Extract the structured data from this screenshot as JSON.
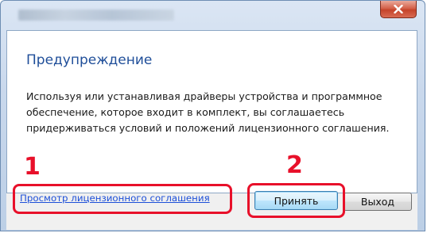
{
  "window": {
    "title": "",
    "close_icon": "close-icon"
  },
  "dialog": {
    "heading": "Предупреждение",
    "body_lines": [
      "Используя или устанавливая драйверы устройства и программное",
      "обеспечение, которое входит в комплект, вы соглашаетесь",
      "придерживаться условий и положений лицензионного соглашения."
    ],
    "license_link": "Просмотр лицензионного соглашения",
    "accept_label": "Принять",
    "exit_label": "Выход"
  },
  "annotations": {
    "marker_1": "1",
    "marker_2": "2",
    "highlight_color": "#e8102a"
  },
  "colors": {
    "heading": "#1f4e99",
    "link": "#1c4fd8",
    "frame": "#c9d8ec"
  }
}
